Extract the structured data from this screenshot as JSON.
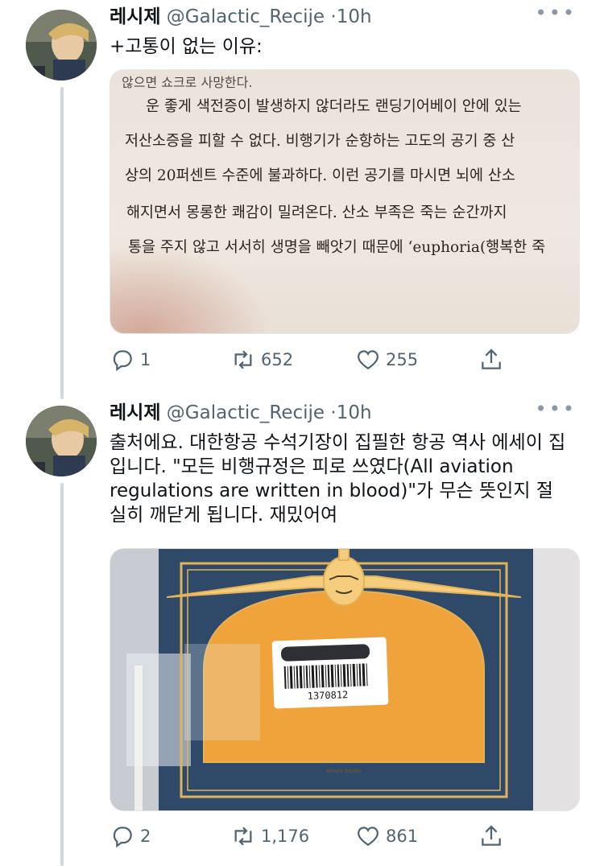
{
  "tweets": [
    {
      "name": "레시제",
      "handle": "@Galactic_Recije",
      "dot": "·",
      "time": "10h",
      "text": "+고통이 없는 이유:",
      "book_page_lines": [
        "않으면 쇼크로 사망한다.",
        "운 좋게 색전증이 발생하지 않더라도 랜딩기어베이 안에 있는",
        "저산소증을 피할 수 없다. 비행기가 순항하는 고도의 공기 중 산",
        "상의 20퍼센트 수준에 불과하다. 이런 공기를 마시면 뇌에 산소",
        "해지면서 몽롱한 쾌감이 밀려온다. 산소 부족은 죽는 순간까지",
        "통을 주지 않고 서서히 생명을 빼앗기 때문에 ‘euphoria(행복한 죽"
      ],
      "replies": "1",
      "retweets": "652",
      "likes": "255"
    },
    {
      "name": "레시제",
      "handle": "@Galactic_Recije",
      "dot": "·",
      "time": "10h",
      "text": "출처에요. 대한항공 수석기장이 집필한 항공 역사 에세이 집입니다. \"모든 비행규정은 피로 쓰였다(All aviation regulations are written in blood)\"가 무슨 뜻인지 절실히 깨닫게 됩니다. 재밌어여",
      "barcode_number": "1370812",
      "publisher_logo": "whale books",
      "replies": "2",
      "retweets": "1,176",
      "likes": "861"
    }
  ],
  "icons": {
    "reply": "reply-icon",
    "retweet": "retweet-icon",
    "like": "heart-icon",
    "share": "share-icon",
    "more": "more-icon"
  },
  "colors": {
    "thread_line": "#cfd9de",
    "secondary_text": "#536471",
    "book_cover_blue": "#2f4a68",
    "book_cover_orange": "#f0a33a"
  }
}
